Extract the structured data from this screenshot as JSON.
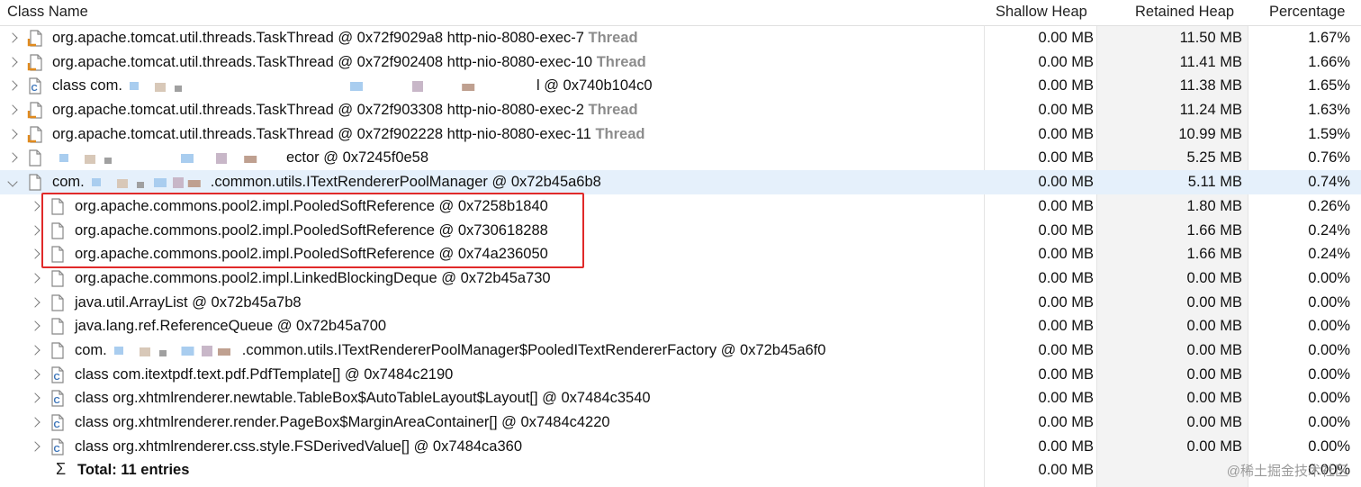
{
  "columns": {
    "class_name": "Class Name",
    "shallow_heap": "Shallow Heap",
    "retained_heap": "Retained Heap",
    "percentage": "Percentage"
  },
  "colors": {
    "selected_row": "#e5f0fb",
    "highlight_box": "#e02a2a",
    "thread_label": "#8c8c8c",
    "class_icon": "#3a73b8",
    "thread_icon": "#e08a1e"
  },
  "rows": [
    {
      "icon": "thread-object-icon",
      "expand": "collapsed",
      "name": "org.apache.tomcat.util.threads.TaskThread @ 0x72f9029a8  http-nio-8080-exec-7",
      "suffix": "Thread",
      "shallow": "0.00 MB",
      "retained": "11.50 MB",
      "pct": "1.67%"
    },
    {
      "icon": "thread-object-icon",
      "expand": "collapsed",
      "name": "org.apache.tomcat.util.threads.TaskThread @ 0x72f902408  http-nio-8080-exec-10",
      "suffix": "Thread",
      "shallow": "0.00 MB",
      "retained": "11.41 MB",
      "pct": "1.66%"
    },
    {
      "icon": "class-object-icon",
      "expand": "collapsed",
      "name_pre": "class com.",
      "name_post": "l @ 0x740b104c0",
      "shallow": "0.00 MB",
      "retained": "11.38 MB",
      "pct": "1.65%"
    },
    {
      "icon": "thread-object-icon",
      "expand": "collapsed",
      "name": "org.apache.tomcat.util.threads.TaskThread @ 0x72f903308  http-nio-8080-exec-2",
      "suffix": "Thread",
      "shallow": "0.00 MB",
      "retained": "11.24 MB",
      "pct": "1.63%"
    },
    {
      "icon": "thread-object-icon",
      "expand": "collapsed",
      "name": "org.apache.tomcat.util.threads.TaskThread @ 0x72f902228  http-nio-8080-exec-11",
      "suffix": "Thread",
      "shallow": "0.00 MB",
      "retained": "10.99 MB",
      "pct": "1.59%"
    },
    {
      "icon": "object-icon",
      "expand": "collapsed",
      "name_pre": "",
      "name_post": "ector @ 0x7245f0e58",
      "shallow": "0.00 MB",
      "retained": "5.25 MB",
      "pct": "0.76%"
    },
    {
      "icon": "object-icon",
      "expand": "expanded",
      "name_pre": "com.",
      "name_post": ".common.utils.ITextRendererPoolManager @ 0x72b45a6b8",
      "shallow": "0.00 MB",
      "retained": "5.11 MB",
      "pct": "0.74%",
      "selected": true
    },
    {
      "icon": "object-icon",
      "expand": "collapsed",
      "child": true,
      "name": "org.apache.commons.pool2.impl.PooledSoftReference @ 0x7258b1840",
      "shallow": "0.00 MB",
      "retained": "1.80 MB",
      "pct": "0.26%"
    },
    {
      "icon": "object-icon",
      "expand": "collapsed",
      "child": true,
      "name": "org.apache.commons.pool2.impl.PooledSoftReference @ 0x730618288",
      "shallow": "0.00 MB",
      "retained": "1.66 MB",
      "pct": "0.24%"
    },
    {
      "icon": "object-icon",
      "expand": "collapsed",
      "child": true,
      "name": "org.apache.commons.pool2.impl.PooledSoftReference @ 0x74a236050",
      "shallow": "0.00 MB",
      "retained": "1.66 MB",
      "pct": "0.24%"
    },
    {
      "icon": "object-icon",
      "expand": "collapsed",
      "child": true,
      "name": "org.apache.commons.pool2.impl.LinkedBlockingDeque @ 0x72b45a730",
      "shallow": "0.00 MB",
      "retained": "0.00 MB",
      "pct": "0.00%"
    },
    {
      "icon": "object-icon",
      "expand": "collapsed",
      "child": true,
      "name": "java.util.ArrayList @ 0x72b45a7b8",
      "shallow": "0.00 MB",
      "retained": "0.00 MB",
      "pct": "0.00%"
    },
    {
      "icon": "object-icon",
      "expand": "collapsed",
      "child": true,
      "name": "java.lang.ref.ReferenceQueue @ 0x72b45a700",
      "shallow": "0.00 MB",
      "retained": "0.00 MB",
      "pct": "0.00%"
    },
    {
      "icon": "object-icon",
      "expand": "collapsed",
      "child": true,
      "name_pre": "com.",
      "name_post": ".common.utils.ITextRendererPoolManager$PooledITextRendererFactory @ 0x72b45a6f0",
      "shallow": "0.00 MB",
      "retained": "0.00 MB",
      "pct": "0.00%"
    },
    {
      "icon": "class-object-icon",
      "expand": "collapsed",
      "child": true,
      "name": "class com.itextpdf.text.pdf.PdfTemplate[] @ 0x7484c2190",
      "shallow": "0.00 MB",
      "retained": "0.00 MB",
      "pct": "0.00%"
    },
    {
      "icon": "class-object-icon",
      "expand": "collapsed",
      "child": true,
      "name": "class org.xhtmlrenderer.newtable.TableBox$AutoTableLayout$Layout[] @ 0x7484c3540",
      "shallow": "0.00 MB",
      "retained": "0.00 MB",
      "pct": "0.00%"
    },
    {
      "icon": "class-object-icon",
      "expand": "collapsed",
      "child": true,
      "name": "class org.xhtmlrenderer.render.PageBox$MarginAreaContainer[] @ 0x7484c4220",
      "shallow": "0.00 MB",
      "retained": "0.00 MB",
      "pct": "0.00%"
    },
    {
      "icon": "class-object-icon",
      "expand": "collapsed",
      "child": true,
      "name": "class org.xhtmlrenderer.css.style.FSDerivedValue[] @ 0x7484ca360",
      "shallow": "0.00 MB",
      "retained": "0.00 MB",
      "pct": "0.00%"
    }
  ],
  "total": {
    "symbol": "Σ",
    "label": "Total: 11 entries",
    "shallow": "0.00 MB",
    "retained": "",
    "pct": "0.00%"
  },
  "watermark": "@稀土掘金技术社区"
}
